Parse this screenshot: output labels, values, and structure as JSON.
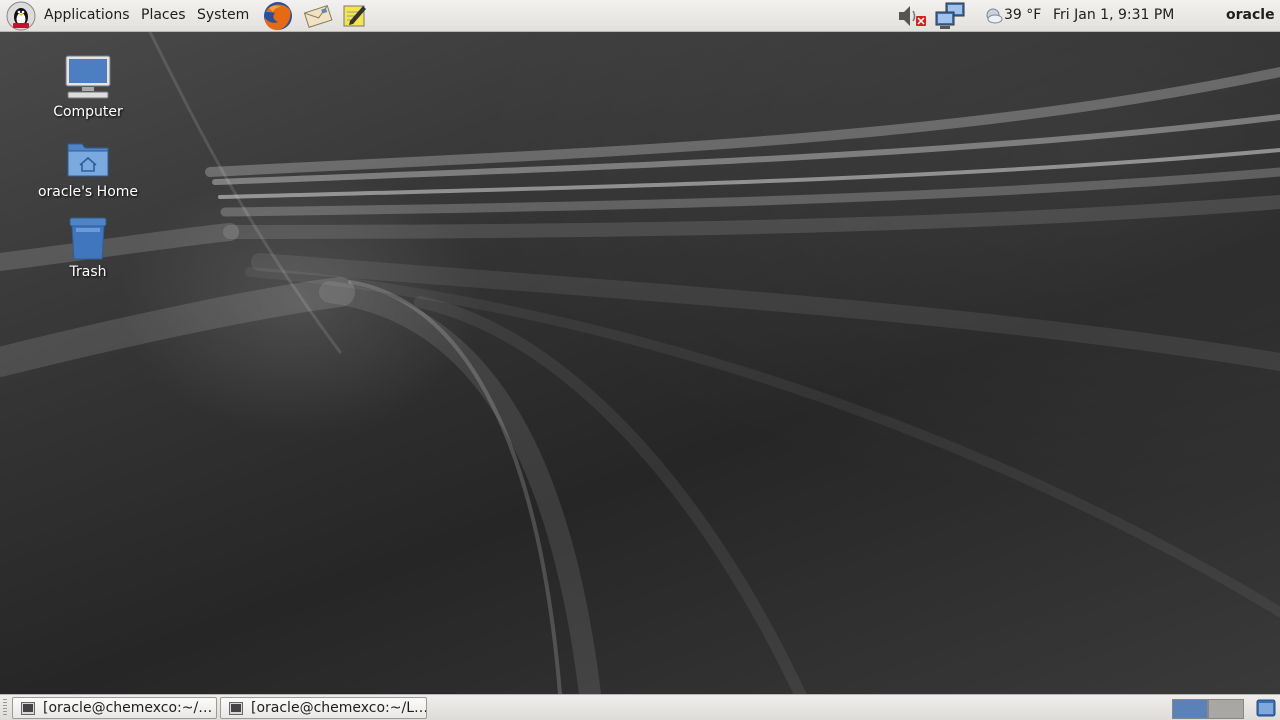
{
  "top_panel": {
    "menus": [
      "Applications",
      "Places",
      "System"
    ],
    "launchers": [
      "firefox-icon",
      "mail-icon",
      "notes-icon"
    ],
    "tray": {
      "volume_icon": "volume-muted-icon",
      "network_icon": "network-icon",
      "weather_icon": "weather-cloud-icon",
      "temperature": "39 °F",
      "clock": "Fri Jan  1,  9:31 PM",
      "user": "oracle"
    }
  },
  "desktop": {
    "icons": [
      {
        "label": "Computer",
        "icon": "computer-icon"
      },
      {
        "label": "oracle's Home",
        "icon": "home-folder-icon"
      },
      {
        "label": "Trash",
        "icon": "trash-icon"
      }
    ]
  },
  "bottom_panel": {
    "tasks": [
      {
        "label": "[oracle@chemexco:~/…",
        "icon": "terminal-icon"
      },
      {
        "label": "[oracle@chemexco:~/L…",
        "icon": "terminal-icon"
      }
    ],
    "workspaces": [
      "workspace-1",
      "workspace-2"
    ],
    "active_workspace": 1,
    "show_desktop_icon": "show-desktop-icon"
  },
  "colors": {
    "panel": "#e8e6e3",
    "workspace_active": "#5b82b8",
    "workspace_inactive": "#a9a7a4",
    "folder_blue": "#6b9bd6"
  }
}
